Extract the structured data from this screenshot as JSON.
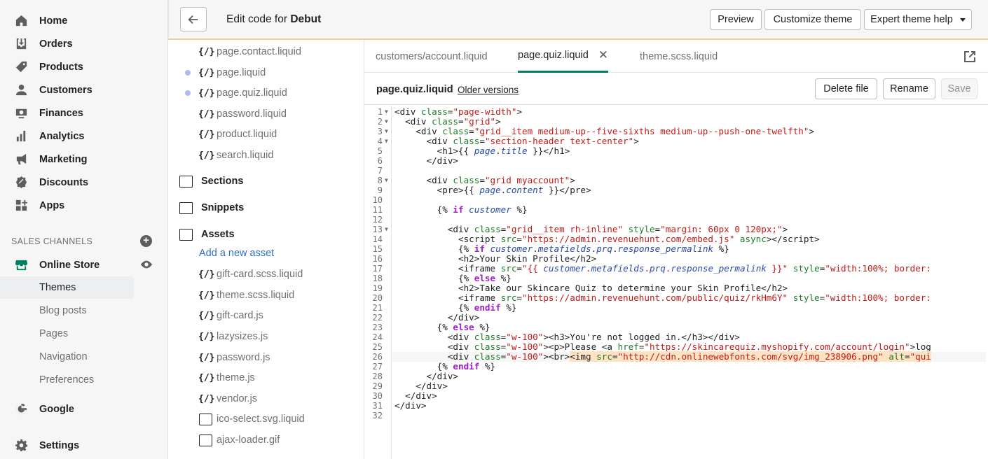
{
  "sidebar": {
    "items": [
      {
        "label": "Home",
        "icon": "home-icon"
      },
      {
        "label": "Orders",
        "icon": "orders-icon"
      },
      {
        "label": "Products",
        "icon": "tag-icon"
      },
      {
        "label": "Customers",
        "icon": "person-icon"
      },
      {
        "label": "Finances",
        "icon": "finances-icon"
      },
      {
        "label": "Analytics",
        "icon": "analytics-icon"
      },
      {
        "label": "Marketing",
        "icon": "megaphone-icon"
      },
      {
        "label": "Discounts",
        "icon": "discount-icon"
      },
      {
        "label": "Apps",
        "icon": "apps-icon"
      }
    ],
    "sales_channels_label": "SALES CHANNELS",
    "online_store": "Online Store",
    "sub_items": [
      "Themes",
      "Blog posts",
      "Pages",
      "Navigation",
      "Preferences"
    ],
    "google": "Google",
    "settings": "Settings",
    "accent_color": "#008060"
  },
  "topbar": {
    "title_prefix": "Edit code for",
    "theme_name": "Debut",
    "preview": "Preview",
    "customize": "Customize theme",
    "expert": "Expert theme help"
  },
  "tree": {
    "top_files": [
      {
        "icon": "{/}",
        "name": "page.contact.liquid",
        "dot": false
      },
      {
        "icon": "{/}",
        "name": "page.liquid",
        "dot": true
      },
      {
        "icon": "{/}",
        "name": "page.quiz.liquid",
        "dot": true
      },
      {
        "icon": "{/}",
        "name": "password.liquid",
        "dot": false
      },
      {
        "icon": "{/}",
        "name": "product.liquid",
        "dot": false
      },
      {
        "icon": "{/}",
        "name": "search.liquid",
        "dot": false
      }
    ],
    "folders": [
      "Sections",
      "Snippets",
      "Assets"
    ],
    "add_asset": "Add a new asset",
    "asset_files": [
      {
        "icon": "{/}",
        "name": "gift-card.scss.liquid"
      },
      {
        "icon": "{/}",
        "name": "theme.scss.liquid"
      },
      {
        "icon": "{/}",
        "name": "gift-card.js"
      },
      {
        "icon": "{/}",
        "name": "lazysizes.js"
      },
      {
        "icon": "{/}",
        "name": "password.js"
      },
      {
        "icon": "{/}",
        "name": "theme.js"
      },
      {
        "icon": "{/}",
        "name": "vendor.js"
      },
      {
        "icon": "image",
        "name": "ico-select.svg.liquid"
      },
      {
        "icon": "image",
        "name": "ajax-loader.gif"
      }
    ]
  },
  "editor": {
    "tabs": [
      "customers/account.liquid",
      "page.quiz.liquid",
      "theme.scss.liquid"
    ],
    "file_name": "page.quiz.liquid",
    "older_versions": "Older versions",
    "delete": "Delete file",
    "rename": "Rename",
    "save": "Save",
    "line_numbers": [
      "1",
      "2",
      "3",
      "4",
      "5",
      "6",
      "7",
      "8",
      "9",
      "10",
      "11",
      "12",
      "13",
      "14",
      "15",
      "16",
      "17",
      "18",
      "19",
      "20",
      "21",
      "22",
      "23",
      "24",
      "25",
      "26",
      "27",
      "28",
      "29",
      "30",
      "31",
      "32"
    ]
  }
}
